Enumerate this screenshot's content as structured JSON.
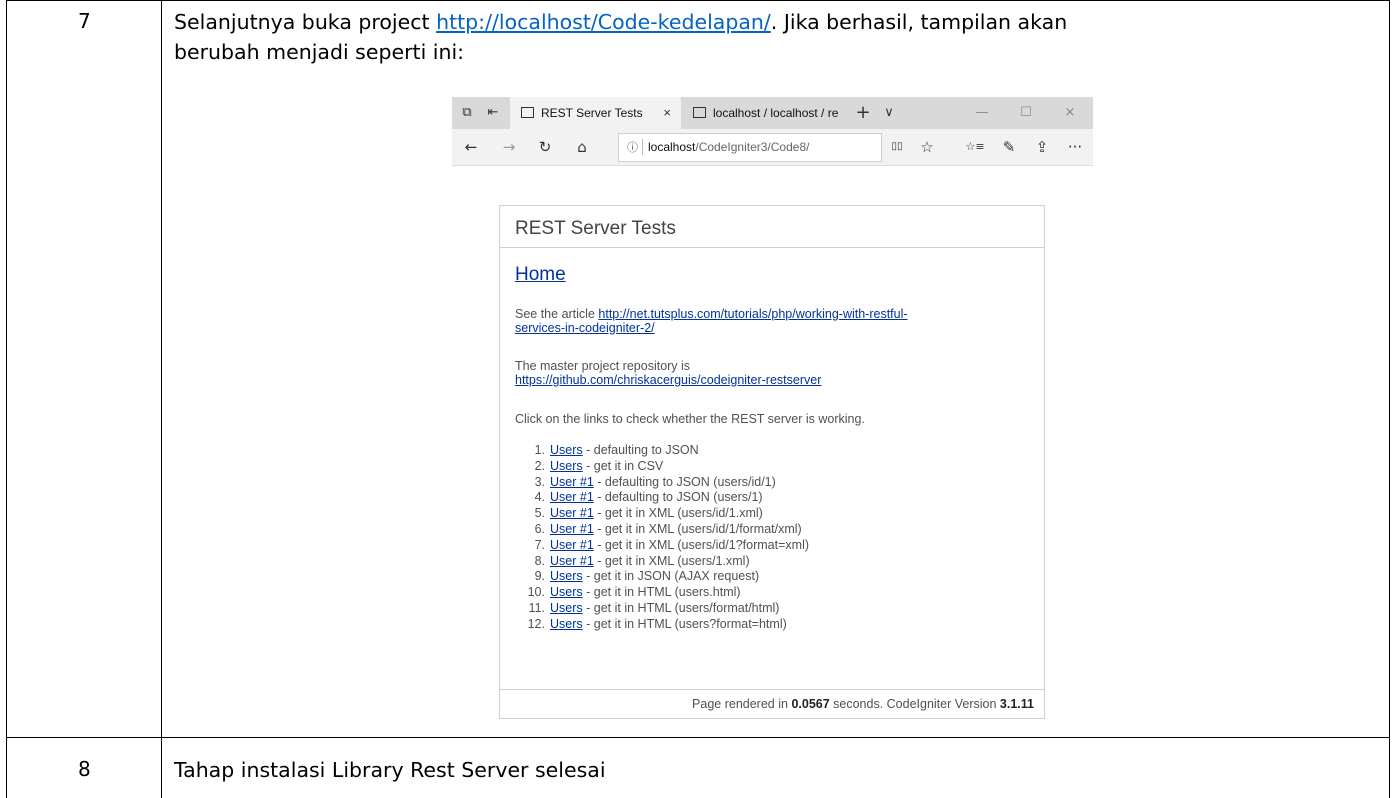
{
  "rows": [
    {
      "number": "7",
      "text_before": "Selanjutnya buka project ",
      "link": "http://localhost/Code-kedelapan/",
      "text_after": ". Jika berhasil, tampilan akan",
      "text_line2": "berubah menjadi seperti ini:"
    },
    {
      "number": "8",
      "text": "Tahap instalasi Library Rest Server selesai"
    }
  ],
  "browser": {
    "tabs": [
      {
        "title": "REST Server Tests",
        "close": "×",
        "active": true
      },
      {
        "title": "localhost / localhost / re",
        "active": false
      }
    ],
    "new_tab": "+",
    "tab_menu": "∨",
    "window": {
      "minimize": "—",
      "maximize": "☐",
      "close": "×"
    },
    "nav": {
      "back": "←",
      "forward": "→",
      "refresh": "↻",
      "home": "⌂"
    },
    "address": {
      "info_icon": "ⓘ",
      "host": "localhost",
      "path": "/CodeIgniter3/Code8/"
    },
    "toolbar": {
      "reading_view": "▯▯",
      "favorite": "☆",
      "favorites_hub": "☆≡",
      "notes": "✎",
      "share": "⇪",
      "more": "···"
    },
    "icons": [
      "tab-preview-icon",
      "set-aside-icon",
      "tab-page-icon"
    ]
  },
  "page": {
    "title": "REST Server Tests",
    "home_link": "Home",
    "article_text": "See the article ",
    "article_link_1": "http://net.tutsplus.com/tutorials/php/working-with-restful-",
    "article_link_2": "services-in-codeigniter-2/",
    "repo_text": "The master project repository is",
    "repo_link": "https://github.com/chriskacerguis/codeigniter-restserver",
    "instruction": "Click on the links to check whether the REST server is working.",
    "tests": [
      {
        "n": "1.",
        "link": "Users",
        "desc": " - defaulting to JSON"
      },
      {
        "n": "2.",
        "link": "Users",
        "desc": " - get it in CSV"
      },
      {
        "n": "3.",
        "link": "User #1",
        "desc": " - defaulting to JSON (users/id/1)"
      },
      {
        "n": "4.",
        "link": "User #1",
        "desc": " - defaulting to JSON (users/1)"
      },
      {
        "n": "5.",
        "link": "User #1",
        "desc": " - get it in XML (users/id/1.xml)"
      },
      {
        "n": "6.",
        "link": "User #1",
        "desc": " - get it in XML (users/id/1/format/xml)"
      },
      {
        "n": "7.",
        "link": "User #1",
        "desc": " - get it in XML (users/id/1?format=xml)"
      },
      {
        "n": "8.",
        "link": "User #1",
        "desc": " - get it in XML (users/1.xml)"
      },
      {
        "n": "9.",
        "link": "Users",
        "desc": " - get it in JSON (AJAX request)"
      },
      {
        "n": "10.",
        "link": "Users",
        "desc": " - get it in HTML (users.html)"
      },
      {
        "n": "11.",
        "link": "Users",
        "desc": " - get it in HTML (users/format/html)"
      },
      {
        "n": "12.",
        "link": "Users",
        "desc": " - get it in HTML (users?format=html)"
      }
    ],
    "footer": {
      "prefix": "Page rendered in ",
      "seconds": "0.0567",
      "middle": " seconds. CodeIgniter Version ",
      "version": "3.1.11"
    }
  },
  "colors": {
    "link": "#0563c1",
    "page_link": "#003399",
    "tab_bar": "#d9d9d9",
    "toolbar": "#f2f2f2"
  }
}
